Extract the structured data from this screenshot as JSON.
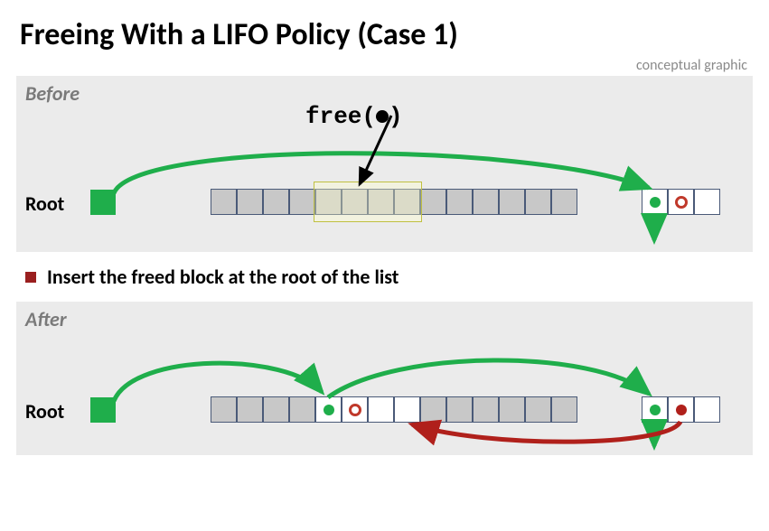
{
  "title": "Freeing With a LIFO Policy (Case 1)",
  "subtitle": "conceptual graphic",
  "before": {
    "label": "Before",
    "root": "Root",
    "free_call": "free( )"
  },
  "bullet": "Insert the freed block at the root of the list",
  "after": {
    "label": "After",
    "root": "Root"
  },
  "colors": {
    "green": "#1fae4b",
    "red": "#b0201b",
    "darkred": "#9a1f1f"
  }
}
